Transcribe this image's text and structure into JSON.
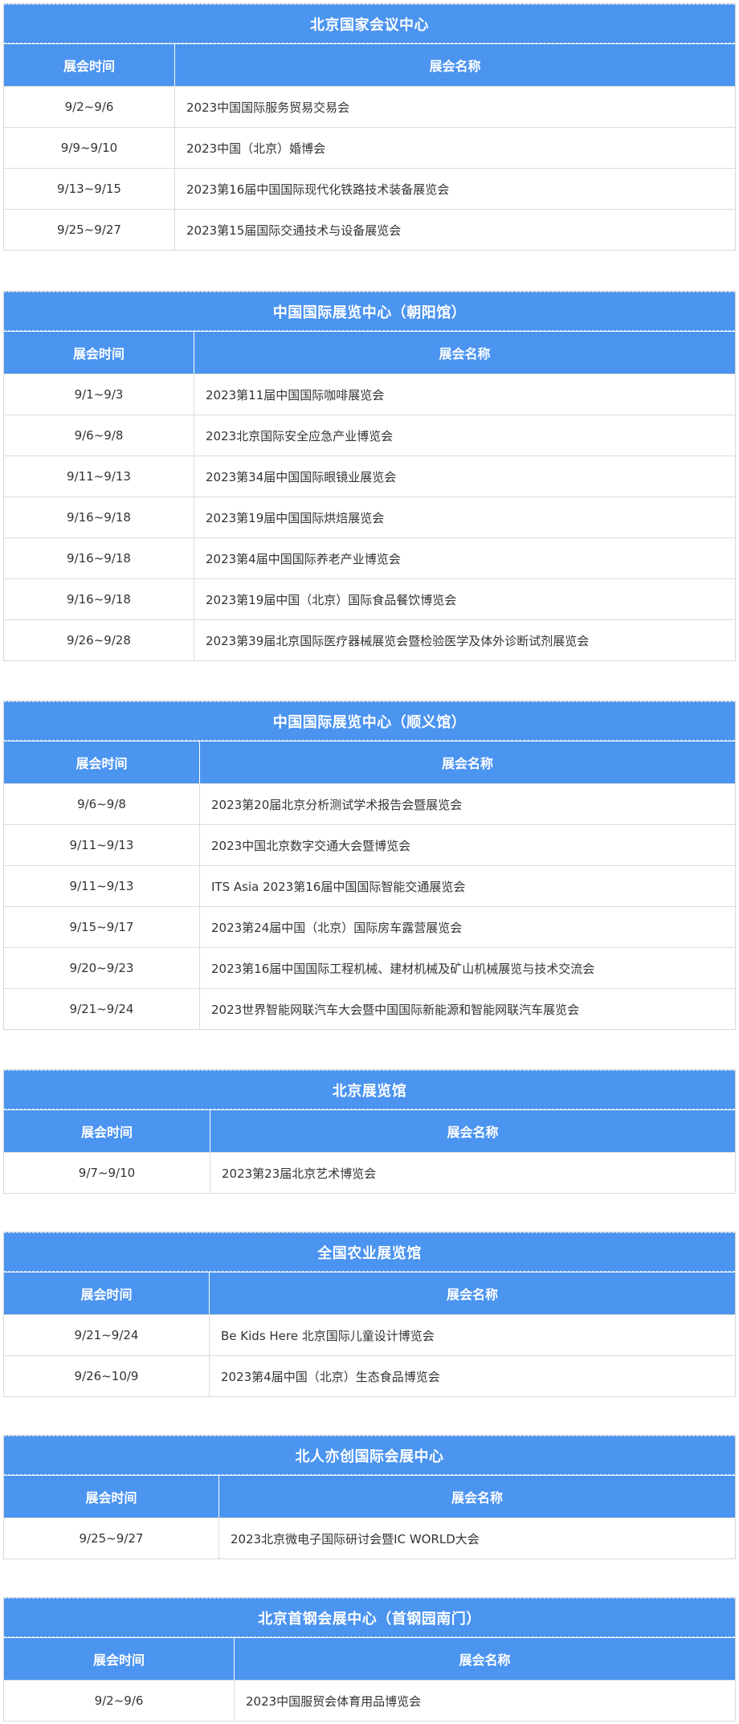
{
  "headers": {
    "date": "展会时间",
    "name": "展会名称"
  },
  "venues": [
    {
      "title": "北京国家会议中心",
      "rows": [
        {
          "date": "9/2~9/6",
          "name": "2023中国国际服务贸易交易会"
        },
        {
          "date": "9/9~9/10",
          "name": "2023中国（北京）婚博会"
        },
        {
          "date": "9/13~9/15",
          "name": "2023第16届中国国际现代化铁路技术装备展览会"
        },
        {
          "date": "9/25~9/27",
          "name": "2023第15届国际交通技术与设备展览会"
        }
      ]
    },
    {
      "title": "中国国际展览中心（朝阳馆）",
      "rows": [
        {
          "date": "9/1~9/3",
          "name": "2023第11届中国国际咖啡展览会"
        },
        {
          "date": "9/6~9/8",
          "name": "2023北京国际安全应急产业博览会"
        },
        {
          "date": "9/11~9/13",
          "name": "2023第34届中国国际眼镜业展览会"
        },
        {
          "date": "9/16~9/18",
          "name": "2023第19届中国国际烘焙展览会"
        },
        {
          "date": "9/16~9/18",
          "name": "2023第4届中国国际养老产业博览会"
        },
        {
          "date": "9/16~9/18",
          "name": "2023第19届中国（北京）国际食品餐饮博览会"
        },
        {
          "date": "9/26~9/28",
          "name": "2023第39届北京国际医疗器械展览会暨检验医学及体外诊断试剂展览会"
        }
      ]
    },
    {
      "title": "中国国际展览中心（顺义馆）",
      "rows": [
        {
          "date": "9/6~9/8",
          "name": "2023第20届北京分析测试学术报告会暨展览会"
        },
        {
          "date": "9/11~9/13",
          "name": "2023中国北京数字交通大会暨博览会"
        },
        {
          "date": "9/11~9/13",
          "name": "ITS Asia 2023第16届中国国际智能交通展览会"
        },
        {
          "date": "9/15~9/17",
          "name": "2023第24届中国（北京）国际房车露营展览会"
        },
        {
          "date": "9/20~9/23",
          "name": "2023第16届中国国际工程机械、建材机械及矿山机械展览与技术交流会"
        },
        {
          "date": "9/21~9/24",
          "name": "2023世界智能网联汽车大会暨中国国际新能源和智能网联汽车展览会"
        }
      ]
    },
    {
      "title": "北京展览馆",
      "rows": [
        {
          "date": "9/7~9/10",
          "name": "2023第23届北京艺术博览会"
        }
      ]
    },
    {
      "title": "全国农业展览馆",
      "rows": [
        {
          "date": "9/21~9/24",
          "name": "Be Kids Here 北京国际儿童设计博览会"
        },
        {
          "date": "9/26~10/9",
          "name": "2023第4届中国（北京）生态食品博览会"
        }
      ]
    },
    {
      "title": "北人亦创国际会展中心",
      "rows": [
        {
          "date": "9/25~9/27",
          "name": "2023北京微电子国际研讨会暨IC WORLD大会"
        }
      ]
    },
    {
      "title": "北京首钢会展中心（首钢园南门）",
      "rows": [
        {
          "date": "9/2~9/6",
          "name": "2023中国服贸会体育用品博览会"
        }
      ]
    }
  ],
  "colors": {
    "header_bg": "#4b94f0",
    "header_text": "#ffffff",
    "border": "#dcdcdc"
  }
}
